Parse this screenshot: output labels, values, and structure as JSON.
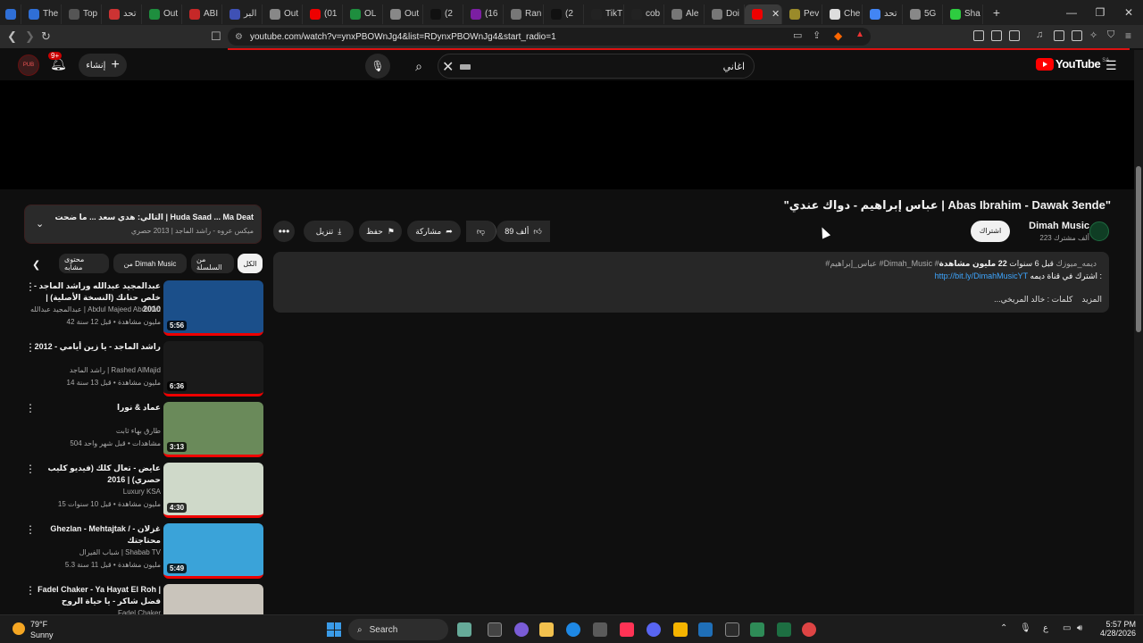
{
  "browser": {
    "tabs": [
      {
        "label": "The",
        "color": "#2f6fd6"
      },
      {
        "label": "Top",
        "color": "#555555"
      },
      {
        "label": "تحد",
        "color": "#c33"
      },
      {
        "label": "Out",
        "color": "#1e8e3e"
      },
      {
        "label": "ABI",
        "color": "#c62828"
      },
      {
        "label": "البر",
        "color": "#3f51b5"
      },
      {
        "label": "Out",
        "color": "#888888"
      },
      {
        "label": "(01",
        "color": "#e00"
      },
      {
        "label": "OL",
        "color": "#1e8e3e"
      },
      {
        "label": "Out",
        "color": "#888888"
      },
      {
        "label": "(2",
        "color": "#111111"
      },
      {
        "label": "(16",
        "color": "#7b1fa2"
      },
      {
        "label": "Ran",
        "color": "#777777"
      },
      {
        "label": "(2",
        "color": "#111111"
      },
      {
        "label": "TikT",
        "color": "#222222"
      },
      {
        "label": "cob",
        "color": "#222222"
      },
      {
        "label": "Ale",
        "color": "#777777"
      },
      {
        "label": "Doi",
        "color": "#777777"
      },
      {
        "label": "",
        "color": "#e00",
        "active": true
      },
      {
        "label": "Pev",
        "color": "#9a8a2a"
      },
      {
        "label": "Che",
        "color": "#dddddd"
      },
      {
        "label": "تحد",
        "color": "#4285f4"
      },
      {
        "label": "5G",
        "color": "#888888"
      },
      {
        "label": "Sha",
        "color": "#2ecc40"
      }
    ],
    "url": "youtube.com/watch?v=ynxPBOWnJg4&list=RDynxPBOWnJg4&start_radio=1"
  },
  "header": {
    "search_value": "اغاني",
    "create_label": "إنشاء",
    "bell_badge": "9+",
    "logo_text": "YouTube",
    "logo_country": "SA"
  },
  "video": {
    "title": "\"عباس إبراهيم - دواك عندي | Abas Ibrahim - Dawak 3ende\"",
    "channel_name": "Dimah Music",
    "channel_subs": "223 ألف مشترك",
    "subscribe_label": "اشتراك",
    "like_count": "89 ألف",
    "share_label": "مشاركة",
    "save_label": "حفظ",
    "download_label": "تنزيل"
  },
  "description": {
    "views": "22 مليون مشاهدة",
    "age": "قبل 6 سنوات",
    "tags": "#عباس_إبراهيم #Dimah_Music #ديمه_ميوزك",
    "subscribe_prefix": "اشترك في قناة ديمه :",
    "link": "http://bit.ly/DimahMusicYT",
    "credits": "كلمات : خالد المريخي",
    "more": "...المزيد"
  },
  "now_playing": {
    "title": "التالي: هدي سعد ... ما ضحت | Huda Saad ... Ma Deat",
    "subtitle": "ميكس عروه - راشد الماجد | 2013 حصري"
  },
  "chips": {
    "all": "الكل",
    "series": "من السلسلة",
    "from": "من Dimah Music",
    "related": "محتوى مشابه"
  },
  "recommendations": [
    {
      "title": "عبدالمجيد عبدالله وراشد الماجد - خلص حنانك (النسخة الأصلية) | 2010",
      "channel": "عبدالمجيد عبدالله | Abdul Majeed Abdullah",
      "meta": "42 مليون مشاهدة • قبل 12 سنة",
      "duration": "5:56",
      "thumb_bg": "#1b4f8a"
    },
    {
      "title": "راشد الماجد - يا زين أيامي - 2012",
      "channel": "راشد الماجد | Rashed AlMajid",
      "meta": "14 مليون مشاهدة • قبل 13 سنة",
      "duration": "6:36",
      "thumb_bg": "#1a1a1a"
    },
    {
      "title": "عماد & نورا",
      "channel": "طارق بهاء ثابت",
      "meta": "504 مشاهدات • قبل شهر واحد",
      "duration": "3:13",
      "thumb_bg": "#6a8a5a"
    },
    {
      "title": "عايض - تعال كلك (فيديو كليب حصري) | 2016",
      "channel": "Luxury KSA",
      "meta": "15 مليون مشاهدة • قبل 10 سنوات",
      "duration": "4:30",
      "thumb_bg": "#cfd9c9"
    },
    {
      "title": "Ghezlan - Mehtajtak / غزلان - محتاجتك",
      "channel": "شباب الفيرال | Shabab TV",
      "meta": "5.3 مليون مشاهدة • قبل 11 سنة",
      "duration": "5:49",
      "thumb_bg": "#3aa3d9"
    },
    {
      "title": "Fadel Chaker - Ya Hayat El Roh | فضل شاكر - يا حياة الروح",
      "channel": "Fadel Chaker",
      "meta": "",
      "duration": "",
      "thumb_bg": "#c9c4bb"
    }
  ],
  "taskbar": {
    "temp": "79°F",
    "weather": "Sunny",
    "search_label": "Search",
    "time": "5:57 PM",
    "date": "4/28/2026"
  }
}
